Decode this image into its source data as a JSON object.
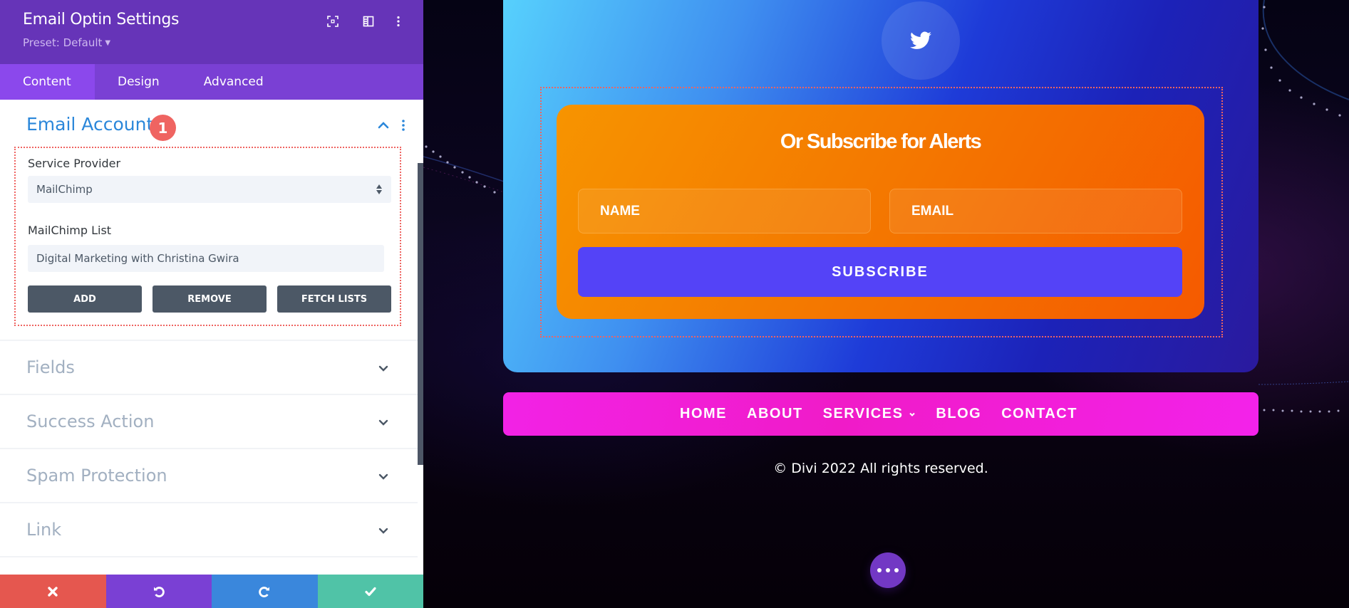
{
  "panel": {
    "title": "Email Optin Settings",
    "preset": "Preset: Default",
    "header_icons": [
      "focus-mode-icon",
      "split-view-icon",
      "more-options-icon"
    ],
    "tabs": [
      {
        "label": "Content",
        "active": true
      },
      {
        "label": "Design",
        "active": false
      },
      {
        "label": "Advanced",
        "active": false
      }
    ],
    "email_account": {
      "title": "Email Account",
      "badge": "1",
      "service_provider": {
        "label": "Service Provider",
        "value": "MailChimp"
      },
      "mailchimp_list": {
        "label": "MailChimp List",
        "value": "Digital Marketing with Christina Gwira"
      },
      "buttons": {
        "add": "ADD",
        "remove": "REMOVE",
        "fetch": "FETCH LISTS"
      }
    },
    "sections": [
      {
        "label": "Fields"
      },
      {
        "label": "Success Action"
      },
      {
        "label": "Spam Protection"
      },
      {
        "label": "Link"
      }
    ],
    "bottom_bar": {
      "cancel": "cancel",
      "undo": "undo",
      "redo": "redo",
      "save": "save"
    }
  },
  "colors": {
    "header_bg": "#6634b8",
    "tabs_bg": "#7a40d4",
    "active_tab_bg": "#8b48ec",
    "accent_blue": "#2b87da",
    "badge_red": "#ef6461",
    "cancel": "#e5574f",
    "undo": "#7a40d4",
    "redo": "#3a87dc",
    "save": "#50c3a7",
    "subscribe": "#5443f7",
    "nav": "#f01bc8"
  },
  "preview": {
    "optin": {
      "title": "Or Subscribe for Alerts",
      "name_placeholder": "NAME",
      "email_placeholder": "EMAIL",
      "button": "SUBSCRIBE"
    },
    "nav": {
      "items": [
        "HOME",
        "ABOUT",
        "SERVICES",
        "BLOG",
        "CONTACT"
      ]
    },
    "footer": "© Divi 2022 All rights reserved."
  }
}
